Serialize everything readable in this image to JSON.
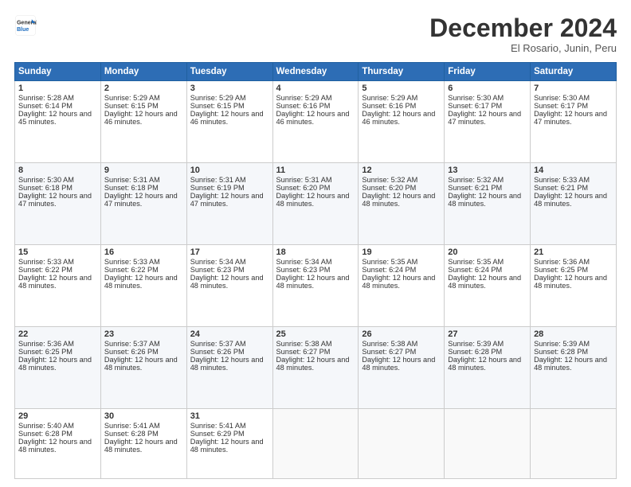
{
  "logo": {
    "line1": "General",
    "line2": "Blue"
  },
  "title": "December 2024",
  "subtitle": "El Rosario, Junin, Peru",
  "days_header": [
    "Sunday",
    "Monday",
    "Tuesday",
    "Wednesday",
    "Thursday",
    "Friday",
    "Saturday"
  ],
  "weeks": [
    [
      {
        "day": "1",
        "rise": "Sunrise: 5:28 AM",
        "set": "Sunset: 6:14 PM",
        "daylight": "Daylight: 12 hours and 45 minutes."
      },
      {
        "day": "2",
        "rise": "Sunrise: 5:29 AM",
        "set": "Sunset: 6:15 PM",
        "daylight": "Daylight: 12 hours and 46 minutes."
      },
      {
        "day": "3",
        "rise": "Sunrise: 5:29 AM",
        "set": "Sunset: 6:15 PM",
        "daylight": "Daylight: 12 hours and 46 minutes."
      },
      {
        "day": "4",
        "rise": "Sunrise: 5:29 AM",
        "set": "Sunset: 6:16 PM",
        "daylight": "Daylight: 12 hours and 46 minutes."
      },
      {
        "day": "5",
        "rise": "Sunrise: 5:29 AM",
        "set": "Sunset: 6:16 PM",
        "daylight": "Daylight: 12 hours and 46 minutes."
      },
      {
        "day": "6",
        "rise": "Sunrise: 5:30 AM",
        "set": "Sunset: 6:17 PM",
        "daylight": "Daylight: 12 hours and 47 minutes."
      },
      {
        "day": "7",
        "rise": "Sunrise: 5:30 AM",
        "set": "Sunset: 6:17 PM",
        "daylight": "Daylight: 12 hours and 47 minutes."
      }
    ],
    [
      {
        "day": "8",
        "rise": "Sunrise: 5:30 AM",
        "set": "Sunset: 6:18 PM",
        "daylight": "Daylight: 12 hours and 47 minutes."
      },
      {
        "day": "9",
        "rise": "Sunrise: 5:31 AM",
        "set": "Sunset: 6:18 PM",
        "daylight": "Daylight: 12 hours and 47 minutes."
      },
      {
        "day": "10",
        "rise": "Sunrise: 5:31 AM",
        "set": "Sunset: 6:19 PM",
        "daylight": "Daylight: 12 hours and 47 minutes."
      },
      {
        "day": "11",
        "rise": "Sunrise: 5:31 AM",
        "set": "Sunset: 6:20 PM",
        "daylight": "Daylight: 12 hours and 48 minutes."
      },
      {
        "day": "12",
        "rise": "Sunrise: 5:32 AM",
        "set": "Sunset: 6:20 PM",
        "daylight": "Daylight: 12 hours and 48 minutes."
      },
      {
        "day": "13",
        "rise": "Sunrise: 5:32 AM",
        "set": "Sunset: 6:21 PM",
        "daylight": "Daylight: 12 hours and 48 minutes."
      },
      {
        "day": "14",
        "rise": "Sunrise: 5:33 AM",
        "set": "Sunset: 6:21 PM",
        "daylight": "Daylight: 12 hours and 48 minutes."
      }
    ],
    [
      {
        "day": "15",
        "rise": "Sunrise: 5:33 AM",
        "set": "Sunset: 6:22 PM",
        "daylight": "Daylight: 12 hours and 48 minutes."
      },
      {
        "day": "16",
        "rise": "Sunrise: 5:33 AM",
        "set": "Sunset: 6:22 PM",
        "daylight": "Daylight: 12 hours and 48 minutes."
      },
      {
        "day": "17",
        "rise": "Sunrise: 5:34 AM",
        "set": "Sunset: 6:23 PM",
        "daylight": "Daylight: 12 hours and 48 minutes."
      },
      {
        "day": "18",
        "rise": "Sunrise: 5:34 AM",
        "set": "Sunset: 6:23 PM",
        "daylight": "Daylight: 12 hours and 48 minutes."
      },
      {
        "day": "19",
        "rise": "Sunrise: 5:35 AM",
        "set": "Sunset: 6:24 PM",
        "daylight": "Daylight: 12 hours and 48 minutes."
      },
      {
        "day": "20",
        "rise": "Sunrise: 5:35 AM",
        "set": "Sunset: 6:24 PM",
        "daylight": "Daylight: 12 hours and 48 minutes."
      },
      {
        "day": "21",
        "rise": "Sunrise: 5:36 AM",
        "set": "Sunset: 6:25 PM",
        "daylight": "Daylight: 12 hours and 48 minutes."
      }
    ],
    [
      {
        "day": "22",
        "rise": "Sunrise: 5:36 AM",
        "set": "Sunset: 6:25 PM",
        "daylight": "Daylight: 12 hours and 48 minutes."
      },
      {
        "day": "23",
        "rise": "Sunrise: 5:37 AM",
        "set": "Sunset: 6:26 PM",
        "daylight": "Daylight: 12 hours and 48 minutes."
      },
      {
        "day": "24",
        "rise": "Sunrise: 5:37 AM",
        "set": "Sunset: 6:26 PM",
        "daylight": "Daylight: 12 hours and 48 minutes."
      },
      {
        "day": "25",
        "rise": "Sunrise: 5:38 AM",
        "set": "Sunset: 6:27 PM",
        "daylight": "Daylight: 12 hours and 48 minutes."
      },
      {
        "day": "26",
        "rise": "Sunrise: 5:38 AM",
        "set": "Sunset: 6:27 PM",
        "daylight": "Daylight: 12 hours and 48 minutes."
      },
      {
        "day": "27",
        "rise": "Sunrise: 5:39 AM",
        "set": "Sunset: 6:28 PM",
        "daylight": "Daylight: 12 hours and 48 minutes."
      },
      {
        "day": "28",
        "rise": "Sunrise: 5:39 AM",
        "set": "Sunset: 6:28 PM",
        "daylight": "Daylight: 12 hours and 48 minutes."
      }
    ],
    [
      {
        "day": "29",
        "rise": "Sunrise: 5:40 AM",
        "set": "Sunset: 6:28 PM",
        "daylight": "Daylight: 12 hours and 48 minutes."
      },
      {
        "day": "30",
        "rise": "Sunrise: 5:41 AM",
        "set": "Sunset: 6:28 PM",
        "daylight": "Daylight: 12 hours and 48 minutes."
      },
      {
        "day": "31",
        "rise": "Sunrise: 5:41 AM",
        "set": "Sunset: 6:29 PM",
        "daylight": "Daylight: 12 hours and 48 minutes."
      },
      null,
      null,
      null,
      null
    ]
  ]
}
